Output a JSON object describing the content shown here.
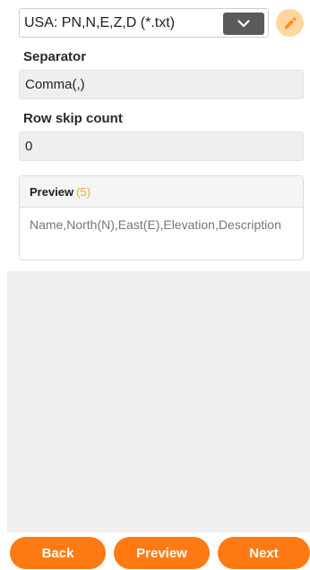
{
  "format": {
    "selected": "USA: PN,N,E,Z,D (*.txt)",
    "dropdown_icon": "chevron-down-icon",
    "edit_icon": "pencil-icon"
  },
  "separator": {
    "label": "Separator",
    "value": "Comma(,)"
  },
  "row_skip": {
    "label": "Row skip count",
    "value": "0"
  },
  "preview": {
    "title": "Preview",
    "count": "(5)",
    "content": "Name,North(N),East(E),Elevation,Description"
  },
  "buttons": {
    "back": "Back",
    "preview": "Preview",
    "next": "Next"
  },
  "colors": {
    "accent": "#ff7a12",
    "edit_bg": "#ffd79c",
    "count_color": "#f5a623"
  }
}
